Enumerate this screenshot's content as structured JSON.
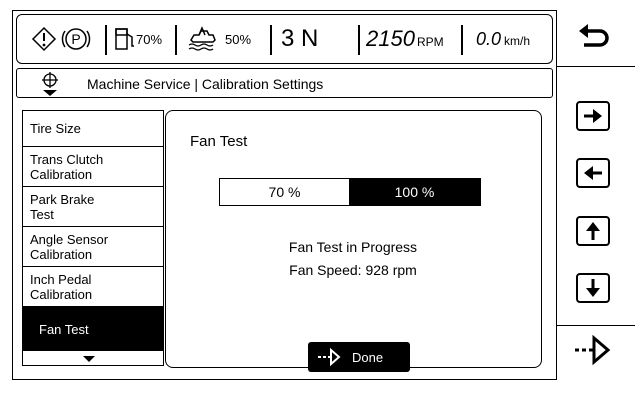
{
  "status_bar": {
    "warning_icon": "warning-icon",
    "park_icon": "park-icon",
    "fuel_icon": "fuel-icon",
    "fuel_value": "70%",
    "def_icon": "def-fluid-icon",
    "def_value": "50%",
    "gear_value": "3 N",
    "rpm_value": "2150",
    "rpm_unit": "RPM",
    "speed_value": "0.0",
    "speed_unit": "km/h"
  },
  "breadcrumb": {
    "icon": "home-icon",
    "text": "Machine Service | Calibration Settings"
  },
  "sidebar": {
    "items": [
      {
        "label": "Tire Size"
      },
      {
        "label": "Trans Clutch Calibration"
      },
      {
        "label": "Park Brake Test"
      },
      {
        "label": "Angle Sensor Calibration"
      },
      {
        "label": "Inch Pedal Calibration"
      },
      {
        "label": "Fan Test",
        "selected": true
      }
    ]
  },
  "main": {
    "title": "Fan Test",
    "speed_options": [
      "70 %",
      "100 %"
    ],
    "selected_option": "100 %",
    "status_line1": "Fan Test in Progress",
    "status_line2": "Fan Speed: 928 rpm",
    "done_label": "Done"
  },
  "right_buttons": [
    {
      "icon": "back-icon"
    },
    {
      "icon": "arrow-right-icon"
    },
    {
      "icon": "arrow-left-icon"
    },
    {
      "icon": "arrow-up-icon"
    },
    {
      "icon": "arrow-down-icon"
    },
    {
      "icon": "enter-icon"
    }
  ]
}
